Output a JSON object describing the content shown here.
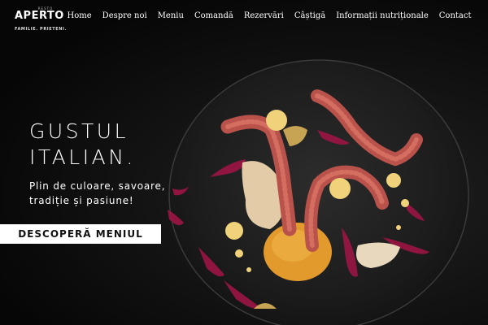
{
  "logo": {
    "small_text": "RESTO",
    "name": "APERTO",
    "tagline": "FAMILIE. PRIETENI."
  },
  "nav": {
    "items": [
      {
        "label": "Home"
      },
      {
        "label": "Despre noi"
      },
      {
        "label": "Meniu"
      },
      {
        "label": "Comandă"
      },
      {
        "label": "Rezervări"
      },
      {
        "label": "Câștigă"
      },
      {
        "label": "Informații nutriționale"
      },
      {
        "label": "Contact"
      }
    ]
  },
  "hero": {
    "title_line1": "GUSTUL",
    "title_line2": "ITALIAN.",
    "subtitle": "Plin de culoare, savoare, tradiție și pasiune!",
    "cta_label": "DESCOPERĂ MENIUL"
  },
  "colors": {
    "background": "#0b0b0b",
    "plate": "#222222",
    "octopus": "#b8534a",
    "beet": "#a1164a",
    "puree": "#e9d3b0"
  }
}
